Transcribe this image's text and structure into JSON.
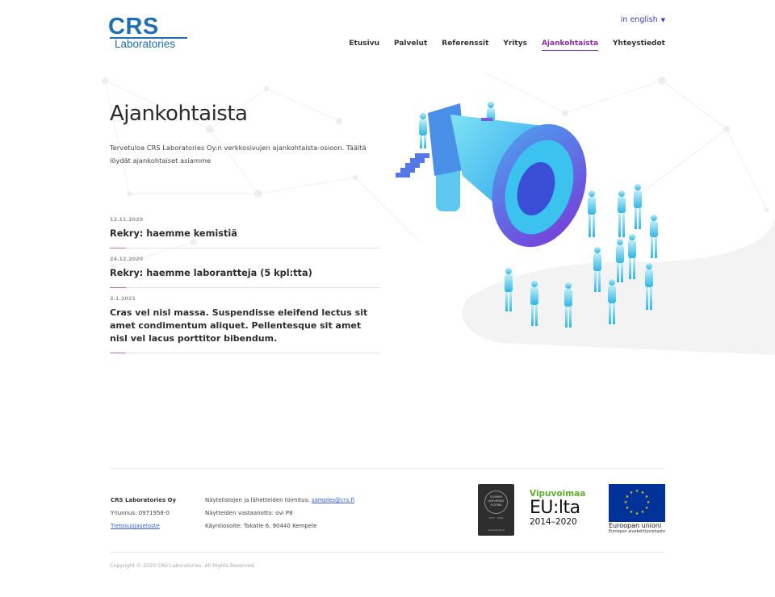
{
  "brand": {
    "logo_top": "CRS",
    "logo_bottom": "Laboratories",
    "color": "#1f6fb6"
  },
  "header": {
    "language_link": "in english",
    "language_caret_icon": "caret-down-icon"
  },
  "nav": {
    "items": [
      {
        "label": "Etusivu",
        "active": false
      },
      {
        "label": "Palvelut",
        "active": false
      },
      {
        "label": "Referenssit",
        "active": false
      },
      {
        "label": "Yritys",
        "active": false
      },
      {
        "label": "Ajankohtaista",
        "active": true
      },
      {
        "label": "Yhteystiedot",
        "active": false
      }
    ],
    "active_color": "#8a2ca8"
  },
  "main": {
    "title": "Ajankohtaista",
    "intro": "Tervetuloa CRS Laboratories Oy:n verkkosivujen ajankohtaista-osioon. Täältä löydät ajankohtaiset asiamme"
  },
  "news": [
    {
      "date": "12.11.2020",
      "title": "Rekry: haemme kemistiä"
    },
    {
      "date": "24.12.2020",
      "title": "Rekry: haemme laborantteja (5 kpl:tta)"
    },
    {
      "date": "3.1.2021",
      "title": "Cras vel nisl massa. Suspendisse eleifend lectus sit amet condimentum aliquet. Pellentesque sit amet nisl vel lacus porttitor bibendum."
    }
  ],
  "illustration": {
    "icon": "megaphone-crowd-illustration"
  },
  "footer": {
    "company": "CRS Laboratories Oy",
    "business_id": "Y-tunnus: 0971958-0",
    "privacy_link": "Tietosuojaseloste",
    "samples_prefix": "Näytelistojen ja lähetteiden toimitus: ",
    "samples_email": "samples@crs.fi",
    "reception": "Näytteiden vastaanotto: ovi P8",
    "visit_address": "Käyntiosoite: Takatie 6, 90440 Kempele",
    "badge": {
      "line1": "SUOMEN",
      "line2": "VAHVIMMAT",
      "line3": "PLATINA",
      "years": "2017 - 2021",
      "site": "asiakastieto.fi"
    },
    "vipuvoimaa": {
      "line1": "Vipuvoimaa",
      "line2": "EU:lta",
      "line3": "2014–2020"
    },
    "eu": {
      "line1": "Euroopan unioni",
      "line2": "Euroopan aluekehitysrahasto",
      "flag_color": "#003399",
      "star_color": "#ffcc00"
    },
    "copyright": "Copyright © 2020 CRS Laboratories. All Rights Reserved."
  }
}
